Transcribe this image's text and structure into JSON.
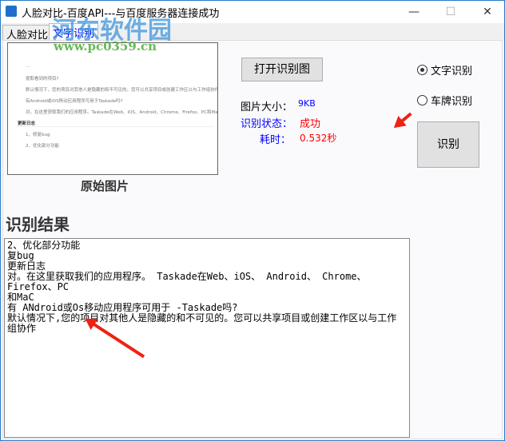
{
  "window": {
    "title": "人脸对比-百度API---与百度服务器连接成功",
    "minimize": "—",
    "maximize": "☐",
    "close": "✕"
  },
  "tabs": [
    {
      "label": "人脸对比"
    },
    {
      "label": "文字识别"
    }
  ],
  "preview": {
    "lines": [
      "...",
      "提取看到的项目?",
      "默认情况下，您的项目对其他人是隐藏的和不可见的。您可以共享项目或创建工作区以与工作组协作。",
      "有Android或iOS移动应用程序可用于Taskade吗?",
      "对。在这里获取我们的应用程序。Taskade在Web、iOS、Android、Chrome、Firefox、PC和Mac上。",
      "更新日志",
      "1、修复bug",
      "2、优化部分功能"
    ],
    "caption": "原始图片"
  },
  "open_button": "打开识别图",
  "info": {
    "size_label": "图片大小：",
    "size_value": "9KB",
    "status_label": "识别状态：",
    "status_value": "成功",
    "time_label": "耗时：",
    "time_value": "0.532秒"
  },
  "mode": {
    "options": [
      "文字识别",
      "车牌识别"
    ],
    "selected": "文字识别"
  },
  "recognize_button": "识别",
  "result": {
    "title": "识别结果",
    "text": "2、优化部分功能\n复bug\n更新日志\n对。在这里获取我们的应用程序。 Taskade在Web、iOS、 Android、 Chrome、 Firefox、PC\n和MaC\n有 ANdroid或Os移动应用程序可用于 -Taskade吗?\n默认情况下,您的项目对其他人是隐藏的和不可见的。您可以共享项目或创建工作区以与工作\n组协作"
  },
  "watermark": {
    "name": "河东软件园",
    "url": "www.pc0359.cn"
  }
}
